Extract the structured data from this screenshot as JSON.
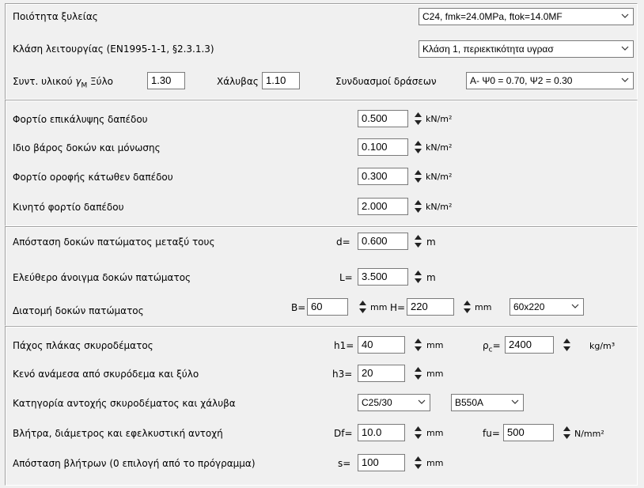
{
  "section1": {
    "wood_quality_label": "Ποιότητα ξυλείας",
    "wood_quality_value": "C24, fmk=24.0MPa, ftok=14.0MF",
    "service_class_label": "Κλάση λειτουργίας (EN1995-1-1, §2.3.1.3)",
    "service_class_value": "Κλάση 1, περιεκτικότητα υγρασ",
    "gamma_label_prefix": "Συντ. υλικού ",
    "gamma_label_gamma": "γ",
    "gamma_label_sub": "M",
    "gamma_label_suffix": " Ξύλο",
    "gamma_wood_value": "1.30",
    "steel_label": "Χάλυβας",
    "gamma_steel_value": "1.10",
    "combinations_label": "Συνδυασμοί δράσεων",
    "combinations_value": "A- Ψ0 = 0.70, Ψ2 = 0.30"
  },
  "section2": {
    "rows": [
      {
        "label": "Φορτίο επικάλυψης δαπέδου",
        "value": "0.500",
        "unit": "kN/m²"
      },
      {
        "label": "Ιδιο βάρος δοκών και μόνωσης",
        "value": "0.100",
        "unit": "kN/m²"
      },
      {
        "label": "Φορτίο οροφής κάτωθεν δαπέδου",
        "value": "0.300",
        "unit": "kN/m²"
      },
      {
        "label": "Κινητό φορτίο δαπέδου",
        "value": "2.000",
        "unit": "kN/m²"
      }
    ]
  },
  "section3": {
    "spacing_label": "Απόσταση δοκών πατώματος μεταξύ τους",
    "spacing_prefix": "d=",
    "spacing_value": "0.600",
    "spacing_unit": "m",
    "span_label": "Ελεύθερο άνοιγμα δοκών πατώματος",
    "span_prefix": "L=",
    "span_value": "3.500",
    "span_unit": "m",
    "section_label": "Διατομή δοκών πατώματος",
    "b_prefix": "B=",
    "b_value": "60",
    "b_unit": "mm",
    "h_prefix": "H=",
    "h_value": "220",
    "h_unit": "mm",
    "section_select_value": "60x220"
  },
  "section4": {
    "slab_label": "Πάχος πλάκας σκυροδέματος",
    "slab_prefix": "h1=",
    "slab_value": "40",
    "slab_unit": "mm",
    "rho_symbol": "ρ",
    "rho_sub": "c",
    "rho_eq": "=",
    "rho_value": "2400",
    "rho_unit": "kg/m³",
    "gap_label": "Κενό ανάμεσα από σκυρόδεμα και ξύλο",
    "gap_prefix": "h3=",
    "gap_value": "20",
    "gap_unit": "mm",
    "grade_label": "Κατηγορία αντοχής σκυροδέματος και χάλυβα",
    "concrete_grade": "C25/30",
    "steel_grade": "B550A",
    "dowel_label": "Βλήτρα, διάμετρος  και εφελκυστική αντοχή",
    "dowel_prefix": "Df=",
    "dowel_value": "10.0",
    "dowel_unit": "mm",
    "fu_prefix": "fu=",
    "fu_value": "500",
    "fu_unit": "N/mm²",
    "dowel_spacing_label": "Απόσταση βλήτρων (0 επιλογή από το πρόγραμμα)",
    "dowel_spacing_prefix": "s=",
    "dowel_spacing_value": "100",
    "dowel_spacing_unit": "mm"
  }
}
